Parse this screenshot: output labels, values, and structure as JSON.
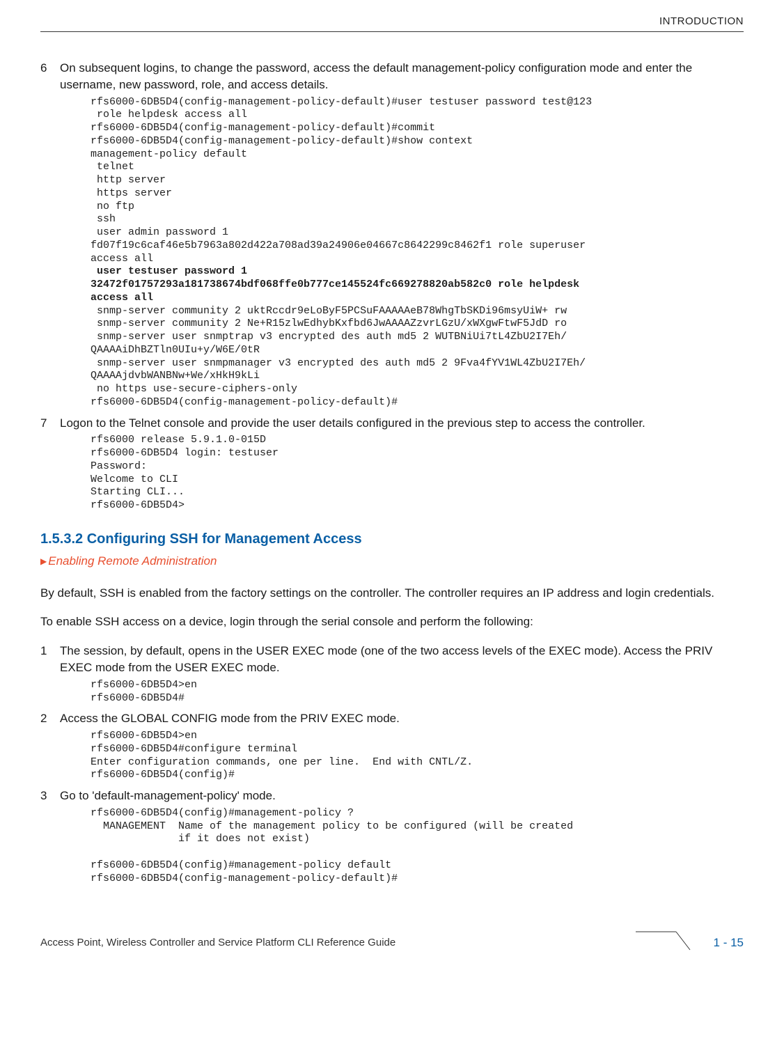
{
  "header": {
    "section": "INTRODUCTION"
  },
  "steps": [
    {
      "num": "6",
      "text": "On subsequent logins, to change the password, access the default management-policy configuration mode and enter the username, new password, role, and access details.",
      "code": "rfs6000-6DB5D4(config-management-policy-default)#user testuser password test@123\n role helpdesk access all\nrfs6000-6DB5D4(config-management-policy-default)#commit\nrfs6000-6DB5D4(config-management-policy-default)#show context\nmanagement-policy default\n telnet\n http server\n https server\n no ftp\n ssh\n user admin password 1 \nfd07f19c6caf46e5b7963a802d422a708ad39a24906e04667c8642299c8462f1 role superuser \naccess all",
      "code_bold": " user testuser password 1 \n32472f01757293a181738674bdf068ffe0b777ce145524fc669278820ab582c0 role helpdesk \naccess all",
      "code_after": " snmp-server community 2 uktRccdr9eLoByF5PCSuFAAAAAeB78WhgTbSKDi96msyUiW+ rw\n snmp-server community 2 Ne+R15zlwEdhybKxfbd6JwAAAAZzvrLGzU/xWXgwFtwF5JdD ro\n snmp-server user snmptrap v3 encrypted des auth md5 2 WUTBNiUi7tL4ZbU2I7Eh/\nQAAAAiDhBZTln0UIu+y/W6E/0tR\n snmp-server user snmpmanager v3 encrypted des auth md5 2 9Fva4fYV1WL4ZbU2I7Eh/\nQAAAAjdvbWANBNw+We/xHkH9kLi\n no https use-secure-ciphers-only\nrfs6000-6DB5D4(config-management-policy-default)#"
    },
    {
      "num": "7",
      "text": "Logon to the Telnet console and provide the user details configured in the previous step to access the controller.",
      "code": "rfs6000 release 5.9.1.0-015D\nrfs6000-6DB5D4 login: testuser\nPassword:\nWelcome to CLI\nStarting CLI...\nrfs6000-6DB5D4>"
    }
  ],
  "subsection": {
    "number": "1.5.3.2",
    "title": "Configuring SSH for Management Access",
    "breadcrumb": "Enabling Remote Administration",
    "para1": "By default, SSH is enabled from the factory settings on the controller. The controller requires an IP address and login credentials.",
    "para2": "To enable SSH access on a device, login through the serial console and perform the following:"
  },
  "steps2": [
    {
      "num": "1",
      "text": "The session, by default, opens in the USER EXEC mode (one of the two access levels of the EXEC mode). Access the PRIV EXEC mode from the USER EXEC mode.",
      "code": "rfs6000-6DB5D4>en\nrfs6000-6DB5D4#"
    },
    {
      "num": "2",
      "text": "Access the GLOBAL CONFIG mode from the PRIV EXEC mode.",
      "code": "rfs6000-6DB5D4>en\nrfs6000-6DB5D4#configure terminal\nEnter configuration commands, one per line.  End with CNTL/Z.\nrfs6000-6DB5D4(config)#"
    },
    {
      "num": "3",
      "text": "Go to 'default-management-policy' mode.",
      "code": "rfs6000-6DB5D4(config)#management-policy ?\n  MANAGEMENT  Name of the management policy to be configured (will be created\n              if it does not exist)\n\nrfs6000-6DB5D4(config)#management-policy default\nrfs6000-6DB5D4(config-management-policy-default)#"
    }
  ],
  "footer": {
    "guide": "Access Point, Wireless Controller and Service Platform CLI Reference Guide",
    "page": "1 - 15"
  }
}
